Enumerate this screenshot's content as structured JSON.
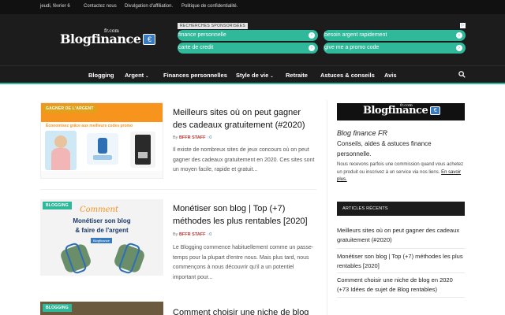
{
  "topbar": {
    "date": "jeudi, février 6",
    "links": [
      "Contactez nous",
      "Divulgation d'affiliation.",
      "Politique de confidentialité."
    ]
  },
  "header": {
    "logo_text": "Blogfinance",
    "logo_suffix": "fr.com",
    "ad": {
      "label": "RECHERCHES SPONSORISÉES",
      "pills": [
        "finance personnelle",
        "besoin argent rapidement",
        "carte de credit",
        "give me a promo code"
      ]
    }
  },
  "nav": {
    "items": [
      "Blogging",
      "Argent",
      "Finances personnelles",
      "Style de vie",
      "Retraite",
      "Astuces & conseils",
      "Avis"
    ],
    "search_icon": "search-icon"
  },
  "posts": [
    {
      "badge": "GAGNER DE L'ARGENT",
      "badge_color": "#e0a21a",
      "title": "Meilleurs sites où on peut gagner des cadeaux gratuitement (#2020)",
      "author": "BFFR STAFF",
      "comments": "0",
      "excerpt": "Il existe de nombreux sites de jeux concours où on peut gagner des cadeaux gratuitement en 2020. Ces sites sont un moyen facile, rapide et gratuit...",
      "thumb_banner": "Économisez grâce aux meilleurs codes promo"
    },
    {
      "badge": "BLOGGING",
      "badge_color": "#2fb89a",
      "title": "Monétiser son blog | Top (+7) méthodes les plus rentables [2020]",
      "author": "BFFR STAFF",
      "comments": "0",
      "excerpt": "Le Blogging commence habituellement comme un passe-temps pour la plupart d'entre nous. Mais plus tard, nous commençons à nous découvrir qu'il a un potentiel important pour...",
      "thumb_lines": [
        "Comment",
        "Monétiser son blog",
        "& faire de l'argent"
      ],
      "thumb_tag": "Blogfinance"
    },
    {
      "badge": "BLOGGING",
      "badge_color": "#2fb89a",
      "title": "Comment choisir une niche de blog"
    }
  ],
  "sidebar": {
    "logo_text": "Blogfinance",
    "logo_suffix": "fr.com",
    "heading": "Blog finance FR",
    "subheading": "Conseils, aides & astuces finance personnelle.",
    "note": "Nous recevons parfois une commission quand vous achetez un produit ou inscrivez à un service via nos liens.",
    "note_link": "En savoir plus.",
    "recent_title": "ARTICLES RÉCENTS",
    "recent": [
      "Meilleurs sites où on peut gagner des cadeaux gratuitement (#2020)",
      "Monétiser son blog | Top (+7) méthodes les plus rentables [2020]",
      "Comment choisir une niche de blog en 2020 (+73 Idées de sujet de Blog rentables)"
    ]
  },
  "colors": {
    "accent": "#2fb89a",
    "dark": "#1c1c1c",
    "author": "#b33333",
    "link": "#3a7bbf"
  }
}
